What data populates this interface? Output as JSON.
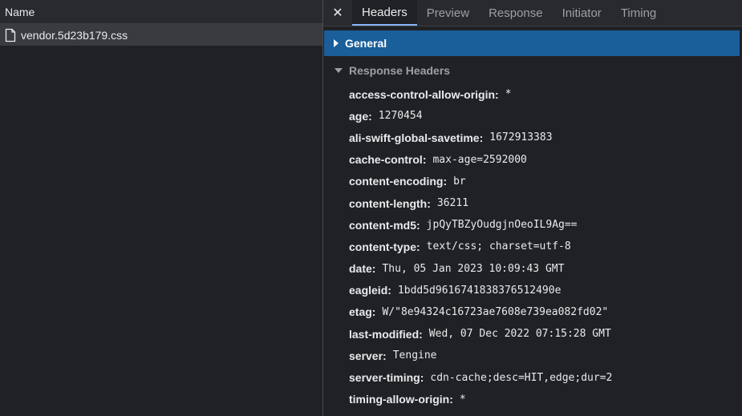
{
  "left": {
    "column_header": "Name",
    "files": [
      {
        "name": "vendor.5d23b179.css",
        "icon": "file-icon"
      }
    ]
  },
  "tabs": {
    "close_glyph": "✕",
    "items": [
      {
        "label": "Headers",
        "active": true
      },
      {
        "label": "Preview",
        "active": false
      },
      {
        "label": "Response",
        "active": false
      },
      {
        "label": "Initiator",
        "active": false
      },
      {
        "label": "Timing",
        "active": false
      }
    ]
  },
  "sections": {
    "general": {
      "label": "General",
      "expanded": false
    },
    "response_headers": {
      "label": "Response Headers",
      "expanded": true
    }
  },
  "response_headers": [
    {
      "name": "access-control-allow-origin",
      "value": "*"
    },
    {
      "name": "age",
      "value": "1270454"
    },
    {
      "name": "ali-swift-global-savetime",
      "value": "1672913383"
    },
    {
      "name": "cache-control",
      "value": "max-age=2592000"
    },
    {
      "name": "content-encoding",
      "value": "br"
    },
    {
      "name": "content-length",
      "value": "36211"
    },
    {
      "name": "content-md5",
      "value": "jpQyTBZyOudgjnOeoIL9Ag=="
    },
    {
      "name": "content-type",
      "value": "text/css; charset=utf-8"
    },
    {
      "name": "date",
      "value": "Thu, 05 Jan 2023 10:09:43 GMT"
    },
    {
      "name": "eagleid",
      "value": "1bdd5d9616741838376512490e"
    },
    {
      "name": "etag",
      "value": "W/\"8e94324c16723ae7608e739ea082fd02\""
    },
    {
      "name": "last-modified",
      "value": "Wed, 07 Dec 2022 07:15:28 GMT"
    },
    {
      "name": "server",
      "value": "Tengine"
    },
    {
      "name": "server-timing",
      "value": "cdn-cache;desc=HIT,edge;dur=2"
    },
    {
      "name": "timing-allow-origin",
      "value": "*"
    }
  ],
  "colors": {
    "background": "#202124",
    "toolbar": "#292a2d",
    "selected_row": "#393b3f",
    "general_bar": "#1a5e9a",
    "active_tab_underline": "#8ab4f8"
  }
}
